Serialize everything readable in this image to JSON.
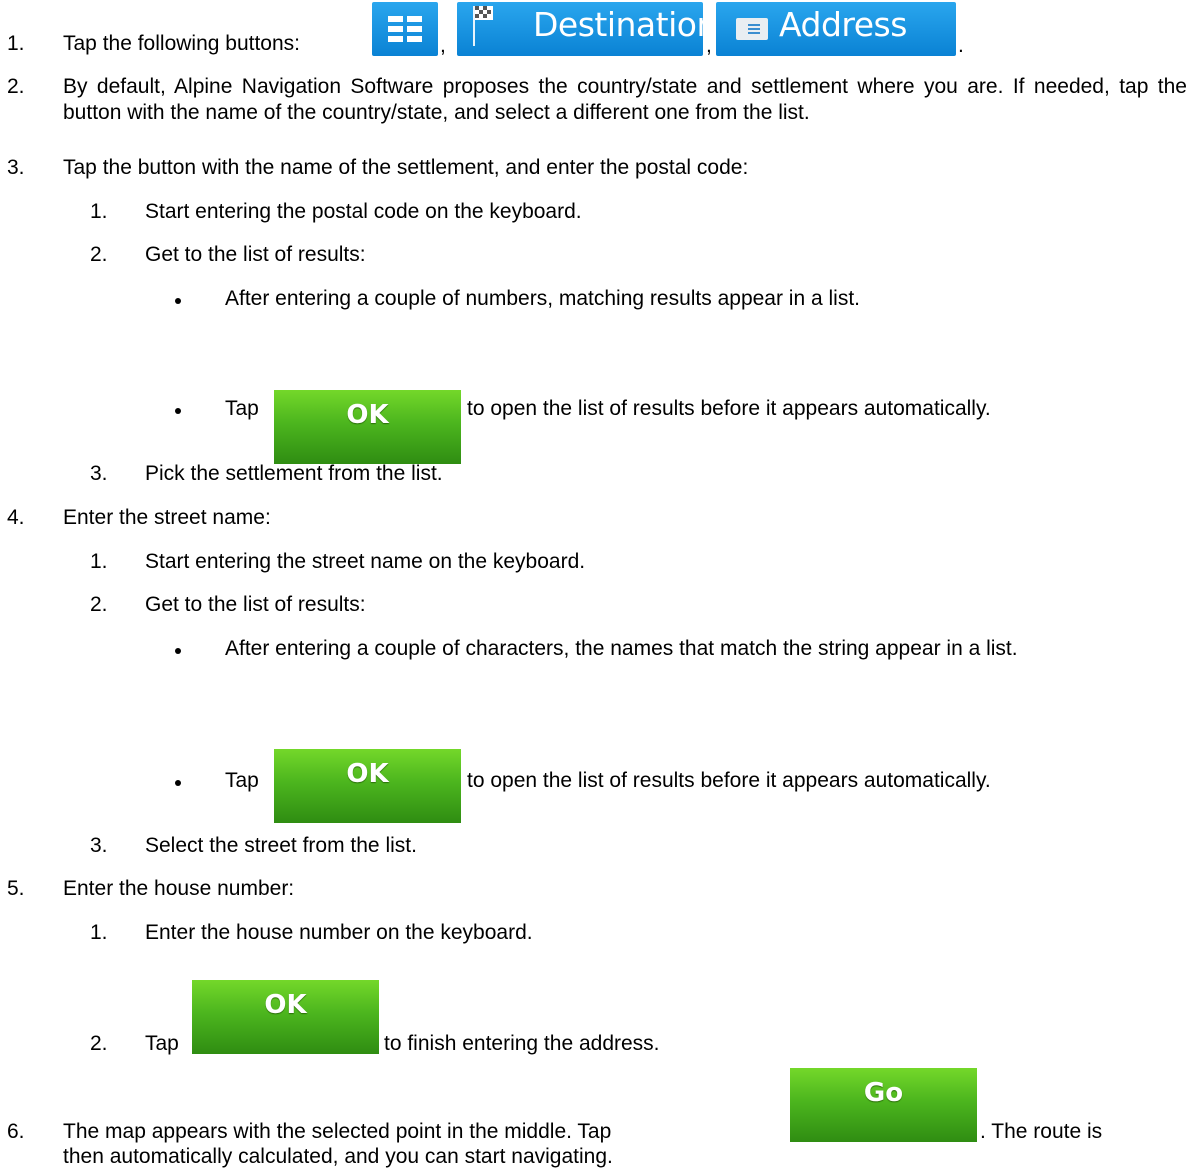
{
  "buttons": {
    "menu_icon": "menu-icon",
    "destination": "Destination",
    "destination_icon": "checkered-flag-icon",
    "address": "Address",
    "address_icon": "address-card-icon",
    "ok": "OK",
    "go": "Go"
  },
  "steps": {
    "s1": {
      "num": "1.",
      "text_before": "Tap the following buttons:",
      "sep1": ",",
      "sep2": ",",
      "end": "."
    },
    "s2": {
      "num": "2.",
      "text": "By default, Alpine Navigation Software proposes the country/state and settlement where you are. If needed, tap the button with the name of the country/state, and select a different one from the list."
    },
    "s3": {
      "num": "3.",
      "text": "Tap the button with the name of the settlement, and enter the postal code:",
      "sub1": {
        "num": "1.",
        "text": "Start entering the postal code on the keyboard."
      },
      "sub2": {
        "num": "2.",
        "text": "Get to the list of results:",
        "b1": "After entering a couple of numbers, matching results appear in a list.",
        "b2_before": "Tap",
        "b2_after": "to open the list of results before it appears automatically."
      },
      "sub3": {
        "num": "3.",
        "text": "Pick the settlement from the list."
      }
    },
    "s4": {
      "num": "4.",
      "text": "Enter the street name:",
      "sub1": {
        "num": "1.",
        "text": "Start entering the street name on the keyboard."
      },
      "sub2": {
        "num": "2.",
        "text": "Get to the list of results:",
        "b1": "After entering a couple of characters, the names that match the string appear in a list.",
        "b2_before": "Tap",
        "b2_after": "to open the list of results before it appears automatically."
      },
      "sub3": {
        "num": "3.",
        "text": "Select the street from the list."
      }
    },
    "s5": {
      "num": "5.",
      "text": "Enter the house number:",
      "sub1": {
        "num": "1.",
        "text": "Enter the house number on the keyboard."
      },
      "sub2": {
        "num": "2.",
        "before": "Tap",
        "after": "to finish entering the address."
      }
    },
    "s6": {
      "num": "6.",
      "before": "The map appears with the selected point in the middle. Tap",
      "after": ". The route is",
      "line2": "then automatically calculated, and you can start navigating."
    }
  }
}
